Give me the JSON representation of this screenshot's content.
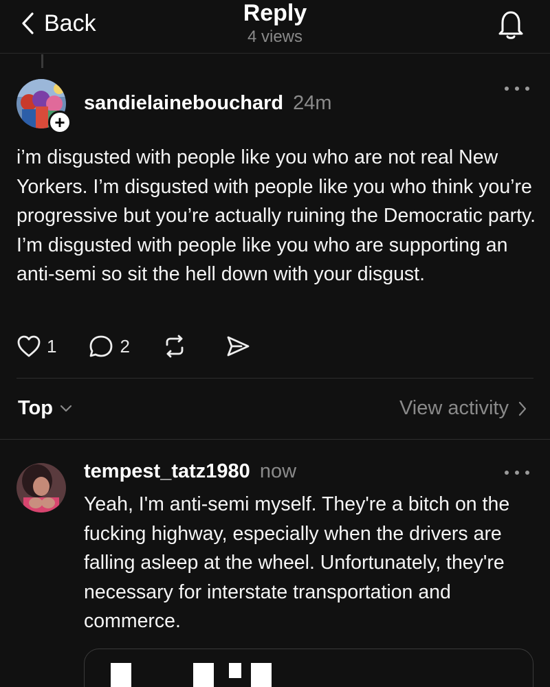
{
  "header": {
    "back_label": "Back",
    "title": "Reply",
    "views": "4 views"
  },
  "post": {
    "username": "sandielainebouchard",
    "time": "24m",
    "body": "i’m disgusted with people like you who are not real New Yorkers. I’m disgusted with people like you who think you’re progressive but you’re actually ruining the Democratic party. I’m disgusted with people like you who are supporting an anti-semi so sit the hell down with your disgust.",
    "likes": "1",
    "replies": "2"
  },
  "sort_bar": {
    "sort_label": "Top",
    "view_activity_label": "View activity"
  },
  "reply": {
    "username": "tempest_tatz1980",
    "time": "now",
    "body": "Yeah, I'm anti-semi myself. They're a bitch on the fucking highway, especially when the drivers are falling asleep at the wheel. Unfortunately, they're necessary for interstate transportation and commerce."
  },
  "colors": {
    "background": "#111111",
    "text": "#f5f5f5",
    "muted": "#8a8a8a",
    "divider": "#2e2e2e"
  },
  "icons": [
    "chevron-left-icon",
    "bell-icon",
    "plus-icon",
    "more-icon",
    "heart-icon",
    "comment-icon",
    "repost-icon",
    "send-icon",
    "chevron-down-icon",
    "chevron-right-icon"
  ]
}
